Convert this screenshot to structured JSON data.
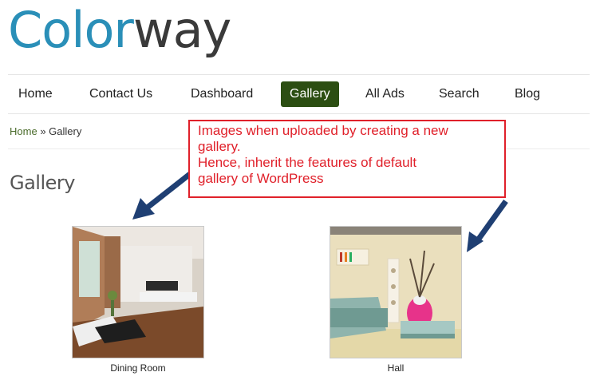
{
  "logo": {
    "part1": "Color",
    "part2": "way"
  },
  "nav": {
    "items": [
      {
        "label": "Home"
      },
      {
        "label": "Contact Us"
      },
      {
        "label": "Dashboard"
      },
      {
        "label": "Gallery",
        "active": true
      },
      {
        "label": "All Ads"
      },
      {
        "label": "Search"
      },
      {
        "label": "Blog"
      }
    ]
  },
  "breadcrumb": {
    "home": "Home",
    "separator": "»",
    "current": "Gallery"
  },
  "page_title": "Gallery",
  "annotation": {
    "lines": [
      "Images when uploaded by creating a new",
      "gallery.",
      "Hence, inherit the features of default",
      "gallery of WordPress"
    ],
    "color": "#e0202a"
  },
  "gallery": [
    {
      "caption": "Dining Room"
    },
    {
      "caption": "Hall"
    }
  ],
  "colors": {
    "accent": "#2c4e12",
    "logo_blue": "#2a8fb8",
    "arrow": "#1f3f73"
  }
}
